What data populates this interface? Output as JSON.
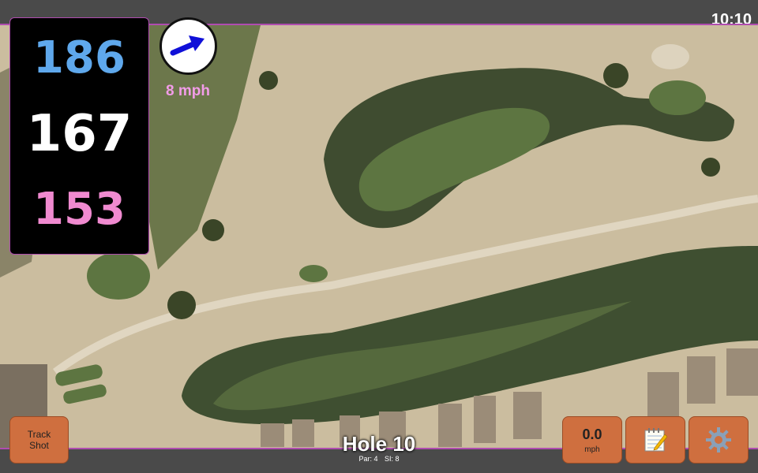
{
  "status_bar": {
    "time": "10:10"
  },
  "distances": {
    "back": {
      "value": "186",
      "color": "#5fa8ec"
    },
    "middle": {
      "value": "167",
      "color": "#ffffff"
    },
    "front": {
      "value": "153",
      "color": "#f08ad0"
    }
  },
  "wind": {
    "speed_label": "8 mph",
    "icon": "wind-direction-arrow-icon",
    "label_color": "#f29ce8"
  },
  "buttons": {
    "track_shot_line1": "Track",
    "track_shot_line2": "Shot",
    "speed_value": "0.0",
    "speed_unit": "mph",
    "notes_icon": "notepad-icon",
    "settings_icon": "gear-icon"
  },
  "hole": {
    "title": "Hole 10",
    "par": "Par: 4",
    "si": "SI: 8"
  },
  "colors": {
    "accent": "#b04cb0",
    "button": "#cf6f3f",
    "bar": "#4a4a4a"
  }
}
